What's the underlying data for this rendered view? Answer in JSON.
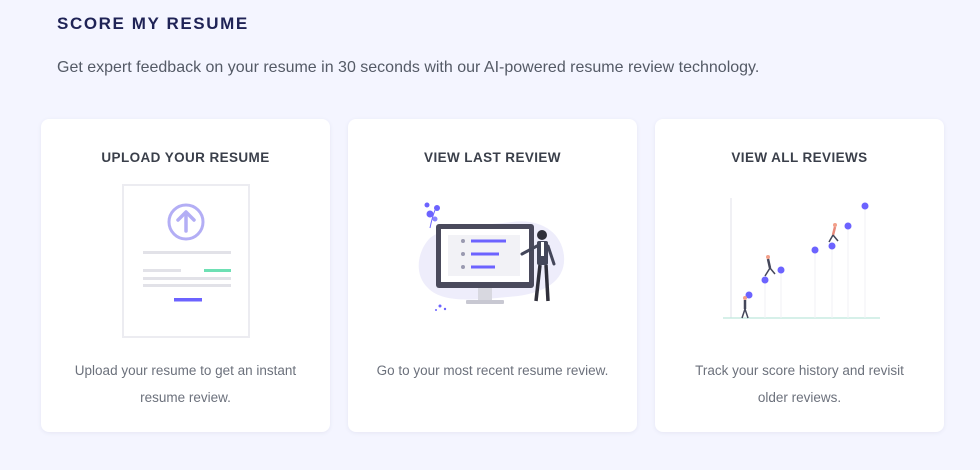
{
  "header": {
    "title": "SCORE MY RESUME",
    "subtitle": "Get expert feedback on your resume in 30 seconds with our AI-powered resume review technology."
  },
  "cards": [
    {
      "title": "UPLOAD YOUR RESUME",
      "description": "Upload your resume to get an instant resume review.",
      "icon": "upload-resume-illustration"
    },
    {
      "title": "VIEW LAST REVIEW",
      "description": "Go to your most recent resume review.",
      "icon": "monitor-presentation-illustration"
    },
    {
      "title": "VIEW ALL REVIEWS",
      "description": "Track your score history and revisit older reviews.",
      "icon": "score-history-chart-illustration"
    }
  ],
  "colors": {
    "background": "#f4f5ff",
    "accent": "#6c63ff",
    "accent_light": "#b3aef5",
    "success": "#6ee0b4",
    "title": "#1f2356"
  }
}
